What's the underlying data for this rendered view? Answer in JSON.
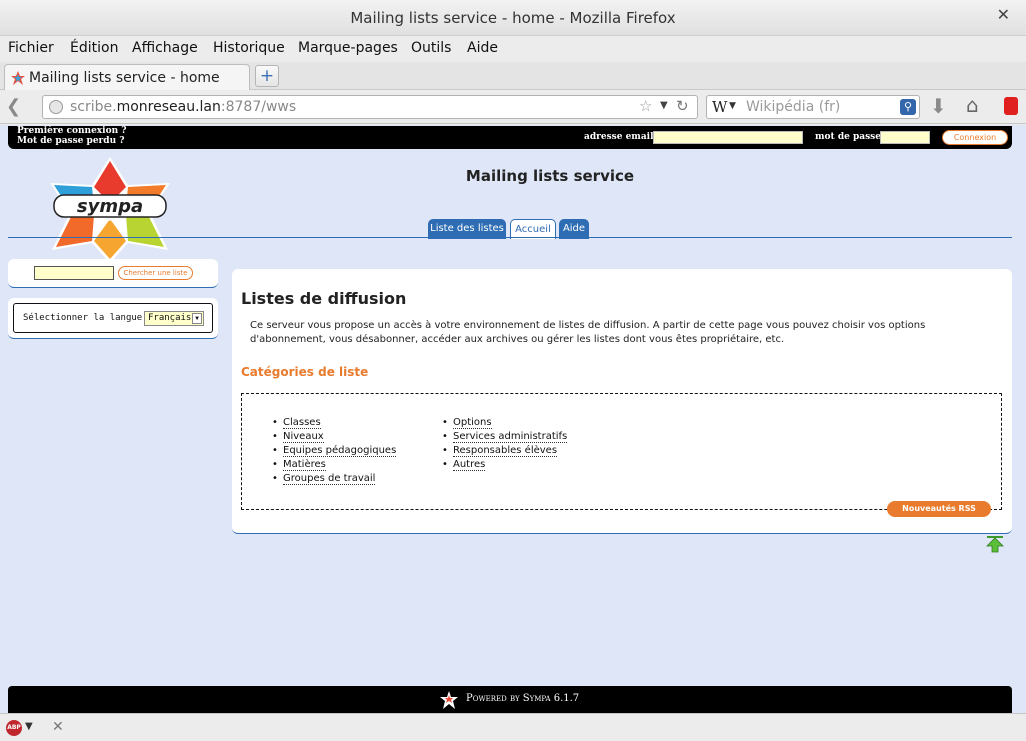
{
  "window": {
    "title": "Mailing lists service - home - Mozilla Firefox"
  },
  "menubar": {
    "items": [
      "Fichier",
      "Édition",
      "Affichage",
      "Historique",
      "Marque-pages",
      "Outils",
      "Aide"
    ]
  },
  "tab": {
    "label": "Mailing lists service - home",
    "new_tab": "+"
  },
  "navbar": {
    "url_host_pre": "scribe.",
    "url_host_main": "monreseau.lan",
    "url_rest": ":8787/wws",
    "search_placeholder": "Wikipédia (fr)"
  },
  "page": {
    "topbar": {
      "first_login": "Première connexion ?",
      "lost_password": "Mot de passe perdu ?",
      "email_label": "adresse email :",
      "password_label": "mot de passe :",
      "login_button": "Connexion"
    },
    "site_title": "Mailing lists service",
    "logo_text": "sympa",
    "nav_tabs": [
      "Liste des listes",
      "Accueil",
      "Aide"
    ],
    "search_button": "Chercher une liste",
    "language_label": "Sélectionner la langue",
    "language_value": "Français",
    "heading": "Listes de diffusion",
    "intro": "Ce serveur vous propose un accès à votre environnement de listes de diffusion. A partir de cette page vous pouvez choisir vos options d'abonnement, vous désabonner, accéder aux archives ou gérer les listes dont vous êtes propriétaire, etc.",
    "categories_heading": "Catégories de liste",
    "categories_col1": [
      "Classes",
      "Niveaux",
      "Equipes pédagogiques",
      "Matières",
      "Groupes de travail"
    ],
    "categories_col2": [
      "Options",
      "Services administratifs",
      "Responsables élèves",
      "Autres"
    ],
    "rss_button": "Nouveautés RSS",
    "footer": "Powered by Sympa 6.1.7"
  },
  "colors": {
    "accent_orange": "#e87b2d",
    "nav_blue": "#2e6db4",
    "page_bg": "#dfe6f8"
  },
  "icons": [
    "firefox-favicon",
    "back-arrow-icon",
    "globe-icon",
    "bookmark-star-icon",
    "reload-icon",
    "wikipedia-icon",
    "search-icon",
    "download-icon",
    "home-icon",
    "extension-icon",
    "adblock-icon",
    "close-icon",
    "scroll-top-icon"
  ]
}
